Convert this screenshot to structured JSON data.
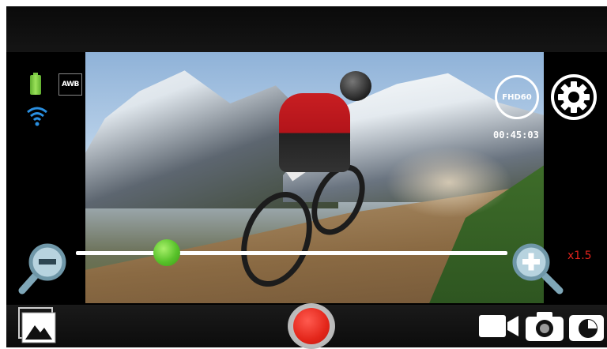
{
  "status": {
    "battery_icon": "battery-full-icon",
    "white_balance": "AWB",
    "wifi_icon": "wifi-icon"
  },
  "video": {
    "resolution_badge": "FHD60",
    "record_time": "00:45:03"
  },
  "zoom": {
    "level_label": "x1.5",
    "slider_fraction": 0.21
  },
  "modes": {
    "active": "video",
    "items": [
      "video",
      "photo",
      "timer"
    ]
  },
  "colors": {
    "record": "#e3261a",
    "zoom_level_text": "#e0231c",
    "slider_thumb": "#58c22a"
  }
}
